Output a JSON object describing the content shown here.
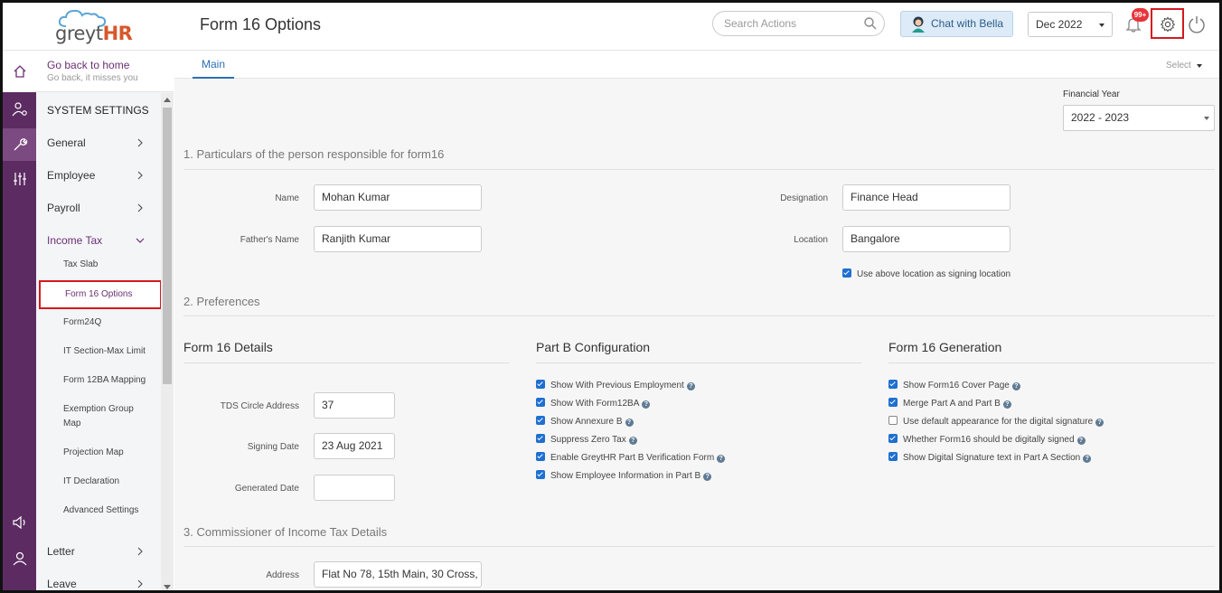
{
  "header": {
    "logo_prefix": "greyt",
    "logo_suffix": "HR",
    "page_title": "Form 16 Options",
    "search_placeholder": "Search Actions",
    "chat_label": "Chat with Bella",
    "period": "Dec 2022",
    "notification_count": "99+"
  },
  "sidebar": {
    "back_title": "Go back to home",
    "back_subtitle": "Go back, it misses you",
    "section_title": "SYSTEM SETTINGS",
    "main_items": [
      "General",
      "Employee",
      "Payroll",
      "Income Tax",
      "Letter",
      "Leave"
    ],
    "sub_items": [
      "Tax Slab",
      "Form 16 Options",
      "Form24Q",
      "IT Section-Max Limit",
      "Form 12BA Mapping",
      "Exemption Group Map",
      "Projection Map",
      "IT Declaration",
      "Advanced Settings"
    ],
    "active_sub": "Form 16 Options"
  },
  "tabs": {
    "main": "Main",
    "select": "Select"
  },
  "financial_year": {
    "label": "Financial Year",
    "value": "2022 - 2023"
  },
  "section1": {
    "title": "1. Particulars of the person responsible for form16",
    "name_label": "Name",
    "name_value": "Mohan Kumar",
    "father_label": "Father's Name",
    "father_value": "Ranjith Kumar",
    "designation_label": "Designation",
    "designation_value": "Finance Head",
    "location_label": "Location",
    "location_value": "Bangalore",
    "use_location_label": "Use above location as signing location",
    "use_location_checked": true
  },
  "section2": {
    "title": "2. Preferences",
    "form16_details": {
      "title": "Form 16 Details",
      "tds_label": "TDS Circle Address",
      "tds_value": "37",
      "signing_label": "Signing Date",
      "signing_value": "23 Aug 2021",
      "generated_label": "Generated Date",
      "generated_value": ""
    },
    "part_b": {
      "title": "Part B Configuration",
      "options": [
        {
          "label": "Show With Previous Employment",
          "checked": true
        },
        {
          "label": "Show With Form12BA",
          "checked": true
        },
        {
          "label": "Show Annexure B",
          "checked": true
        },
        {
          "label": "Suppress Zero Tax",
          "checked": true
        },
        {
          "label": "Enable GreytHR Part B Verification Form",
          "checked": true
        },
        {
          "label": "Show Employee Information in Part B",
          "checked": true
        }
      ]
    },
    "generation": {
      "title": "Form 16 Generation",
      "options": [
        {
          "label": "Show Form16 Cover Page",
          "checked": true
        },
        {
          "label": "Merge Part A and Part B",
          "checked": true
        },
        {
          "label": "Use default appearance for the digital signature",
          "checked": false
        },
        {
          "label": "Whether Form16 should be digitally signed",
          "checked": true
        },
        {
          "label": "Show Digital Signature text in Part A Section",
          "checked": true
        }
      ]
    }
  },
  "section3": {
    "title": "3. Commissioner of Income Tax Details",
    "address_label": "Address",
    "address_value": "Flat No 78, 15th Main, 30 Cross, ."
  },
  "colors": {
    "brand_purple": "#5c2b62",
    "accent_blue": "#2e6fb0",
    "highlight_red": "#d5191f"
  }
}
